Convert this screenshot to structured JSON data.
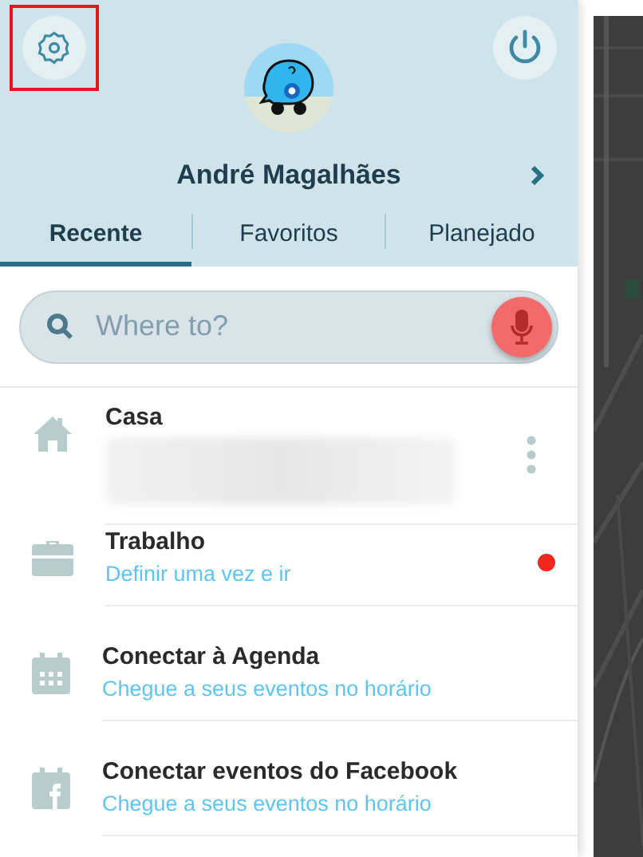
{
  "header": {
    "settings_highlighted": true,
    "user_name": "André Magalhães"
  },
  "tabs": [
    {
      "label": "Recente",
      "selected": true
    },
    {
      "label": "Favoritos",
      "selected": false
    },
    {
      "label": "Planejado",
      "selected": false
    }
  ],
  "search": {
    "placeholder": "Where to?"
  },
  "places": [
    {
      "kind": "home",
      "title": "Casa",
      "address_hidden": true,
      "menu": true,
      "alert": false
    },
    {
      "kind": "work",
      "title": "Trabalho",
      "subtitle": "Definir uma vez e ir",
      "menu": false,
      "alert": true
    },
    {
      "kind": "calendar",
      "title": "Conectar à Agenda",
      "subtitle": "Chegue a seus eventos no horário",
      "menu": false,
      "alert": false
    },
    {
      "kind": "facebook",
      "title": "Conectar eventos do Facebook",
      "subtitle": "Chegue a seus eventos no horário",
      "menu": false,
      "alert": false
    }
  ]
}
